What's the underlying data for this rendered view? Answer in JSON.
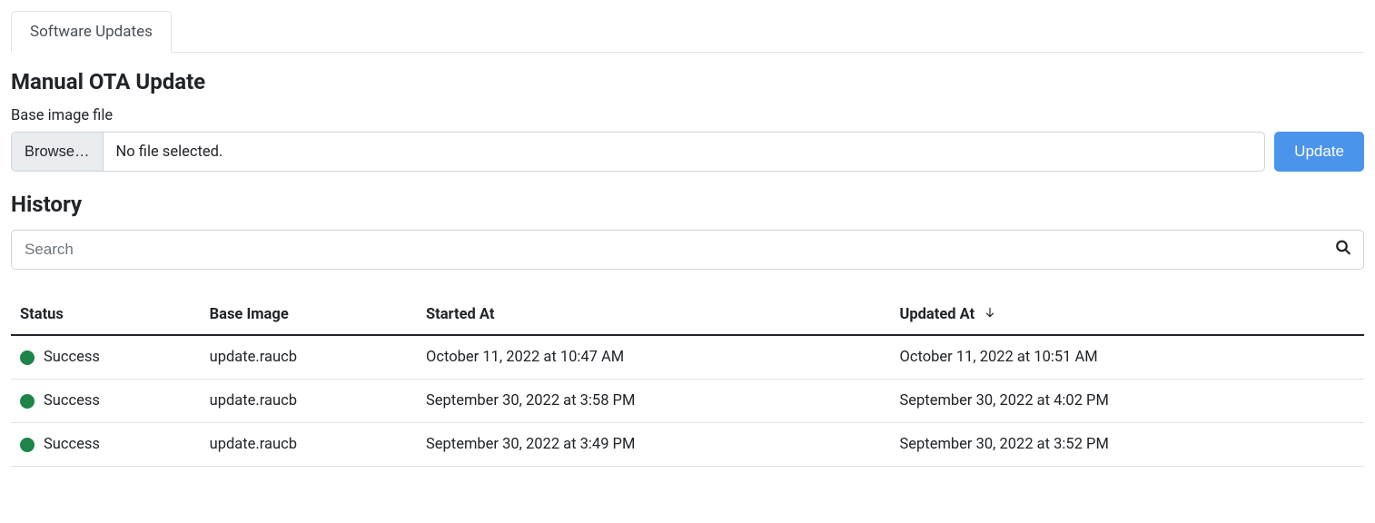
{
  "tabs": {
    "software_updates": "Software Updates"
  },
  "sections": {
    "manual_ota_title": "Manual OTA Update",
    "history_title": "History"
  },
  "file": {
    "label": "Base image file",
    "browse_label": "Browse…",
    "selected_text": "No file selected.",
    "update_label": "Update"
  },
  "search": {
    "placeholder": "Search"
  },
  "table": {
    "headers": {
      "status": "Status",
      "base_image": "Base Image",
      "started_at": "Started At",
      "updated_at": "Updated At"
    },
    "rows": [
      {
        "status": "Success",
        "base_image": "update.raucb",
        "started_at": "October 11, 2022 at 10:47 AM",
        "updated_at": "October 11, 2022 at 10:51 AM"
      },
      {
        "status": "Success",
        "base_image": "update.raucb",
        "started_at": "September 30, 2022 at 3:58 PM",
        "updated_at": "September 30, 2022 at 4:02 PM"
      },
      {
        "status": "Success",
        "base_image": "update.raucb",
        "started_at": "September 30, 2022 at 3:49 PM",
        "updated_at": "September 30, 2022 at 3:52 PM"
      }
    ]
  },
  "colors": {
    "status_success": "#1e8449",
    "primary": "#4b94ec"
  }
}
